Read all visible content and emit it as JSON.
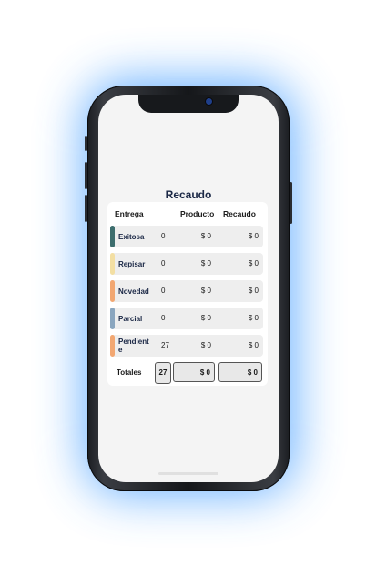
{
  "screen": {
    "title": "Recaudo"
  },
  "table": {
    "headers": {
      "entrega": "Entrega",
      "producto": "Producto",
      "recaudo": "Recaudo"
    },
    "rows": [
      {
        "label": "Exitosa",
        "count": "0",
        "producto": "$ 0",
        "recaudo": "$ 0",
        "color": "#3d6e6e"
      },
      {
        "label": "Repisar",
        "count": "0",
        "producto": "$ 0",
        "recaudo": "$ 0",
        "color": "#f3dfa3"
      },
      {
        "label": "Novedad",
        "count": "0",
        "producto": "$ 0",
        "recaudo": "$ 0",
        "color": "#f2a772"
      },
      {
        "label": "Parcial",
        "count": "0",
        "producto": "$ 0",
        "recaudo": "$ 0",
        "color": "#8aa6bf"
      },
      {
        "label": "Pendiente",
        "count": "27",
        "producto": "$ 0",
        "recaudo": "$ 0",
        "color": "#f2a772"
      }
    ],
    "totals": {
      "label": "Totales",
      "count": "27",
      "producto": "$ 0",
      "recaudo": "$ 0"
    }
  },
  "colors": {
    "glow": "#4fa3ff",
    "title": "#1a2745"
  }
}
